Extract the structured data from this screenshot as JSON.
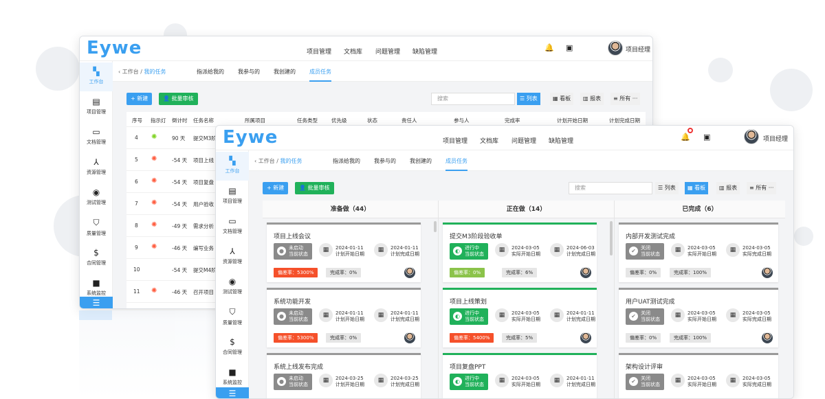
{
  "brand": {
    "logo": "Eywe"
  },
  "topnav": [
    "项目管理",
    "文档库",
    "问题管理",
    "缺陷管理"
  ],
  "user": {
    "name": "项目经理"
  },
  "sidebar": [
    "工作台",
    "项目管理",
    "文档管理",
    "资源管理",
    "测试管理",
    "质量管理",
    "合同管理",
    "系统监控"
  ],
  "breadcrumb": {
    "root": "工作台",
    "sep": "/",
    "current": "我的任务"
  },
  "tabs": [
    "指派给我的",
    "我参与的",
    "我创建的",
    "成员任务"
  ],
  "toolbar": {
    "new": "新建",
    "batch": "批量审核",
    "search_placeholder": "搜索",
    "view_list": "列表",
    "view_board": "看板",
    "view_report": "报表",
    "view_all": "所有"
  },
  "table": {
    "headers": [
      "序号",
      "指示灯",
      "倒计时",
      "任务名称",
      "所属项目",
      "任务类型",
      "优先级",
      "状态",
      "责任人",
      "参与人",
      "完成率",
      "计划开始日期",
      "计划完成日期"
    ],
    "rows": [
      {
        "no": "4",
        "light": "green",
        "countdown": "90 天",
        "name": "提交M3阶"
      },
      {
        "no": "5",
        "light": "red",
        "countdown": "-54 天",
        "name": "项目上线"
      },
      {
        "no": "6",
        "light": "red",
        "countdown": "-54 天",
        "name": "项目复盘"
      },
      {
        "no": "7",
        "light": "red",
        "countdown": "-54 天",
        "name": "用户验收"
      },
      {
        "no": "8",
        "light": "red",
        "countdown": "-49 天",
        "name": "需求分析"
      },
      {
        "no": "9",
        "light": "red",
        "countdown": "-46 天",
        "name": "编写业务"
      },
      {
        "no": "10",
        "light": "none",
        "countdown": "-54 天",
        "name": "提交M4阶"
      },
      {
        "no": "11",
        "light": "red",
        "countdown": "-46 天",
        "name": "召开项目"
      }
    ]
  },
  "board": {
    "columns": [
      {
        "title": "准备做（44）",
        "cards": [
          {
            "title": "项目上线会议",
            "status": [
              "未启动",
              "当前状态"
            ],
            "d1": [
              "2024-01-11",
              "计划开始日期"
            ],
            "d2": [
              "2024-01-11",
              "计划完成日期"
            ],
            "dev": "偏差率：5300%",
            "rate": "完成率：0%"
          },
          {
            "title": "系统功能开发",
            "status": [
              "未启动",
              "当前状态"
            ],
            "d1": [
              "2024-01-11",
              "计划开始日期"
            ],
            "d2": [
              "2024-01-11",
              "计划完成日期"
            ],
            "dev": "偏差率：5300%",
            "rate": "完成率：0%"
          },
          {
            "title": "系统上线发布完成",
            "status": [
              "未启动",
              "当前状态"
            ],
            "d1": [
              "2024-03-25",
              "计划开始日期"
            ],
            "d2": [
              "2024-03-25",
              "计划完成日期"
            ],
            "dev": "",
            "rate": ""
          }
        ]
      },
      {
        "title": "正在做（14）",
        "cards": [
          {
            "title": "提交M3阶段验收单",
            "status": [
              "进行中",
              "当前状态"
            ],
            "d1": [
              "2024-03-05",
              "实际开始日期"
            ],
            "d2": [
              "2024-06-03",
              "计划完成日期"
            ],
            "dev": "偏差率：0%",
            "rate": "完成率：6%"
          },
          {
            "title": "项目上线策划",
            "status": [
              "进行中",
              "当前状态"
            ],
            "d1": [
              "2024-03-05",
              "实际开始日期"
            ],
            "d2": [
              "2024-01-11",
              "计划完成日期"
            ],
            "dev": "偏差率：5400%",
            "rate": "完成率：5%"
          },
          {
            "title": "项目复盘PPT",
            "status": [
              "进行中",
              "当前状态"
            ],
            "d1": [
              "2024-03-05",
              "实际开始日期"
            ],
            "d2": [
              "2024-01-11",
              "计划完成日期"
            ],
            "dev": "",
            "rate": ""
          }
        ]
      },
      {
        "title": "已完成（6）",
        "cards": [
          {
            "title": "内部开发测试完成",
            "status": [
              "关闭",
              "当前状态"
            ],
            "d1": [
              "2024-03-05",
              "实际开始日期"
            ],
            "d2": [
              "2024-03-05",
              "实际完成日期"
            ],
            "dev": "偏差率：0%",
            "rate": "完成率：100%"
          },
          {
            "title": "用户UAT测试完成",
            "status": [
              "关闭",
              "当前状态"
            ],
            "d1": [
              "2024-03-05",
              "实际开始日期"
            ],
            "d2": [
              "2024-03-05",
              "实际完成日期"
            ],
            "dev": "偏差率：0%",
            "rate": "完成率：100%"
          },
          {
            "title": "架构设计评审",
            "status": [
              "关闭",
              "当前状态"
            ],
            "d1": [
              "2024-03-05",
              "实际开始日期"
            ],
            "d2": [
              "2024-03-05",
              "实际完成日期"
            ],
            "dev": "",
            "rate": ""
          }
        ]
      }
    ]
  },
  "colors": {
    "primary": "#3a9ff0",
    "green": "#20b15a",
    "red": "#f5502a",
    "grey": "#8a8a8a"
  }
}
